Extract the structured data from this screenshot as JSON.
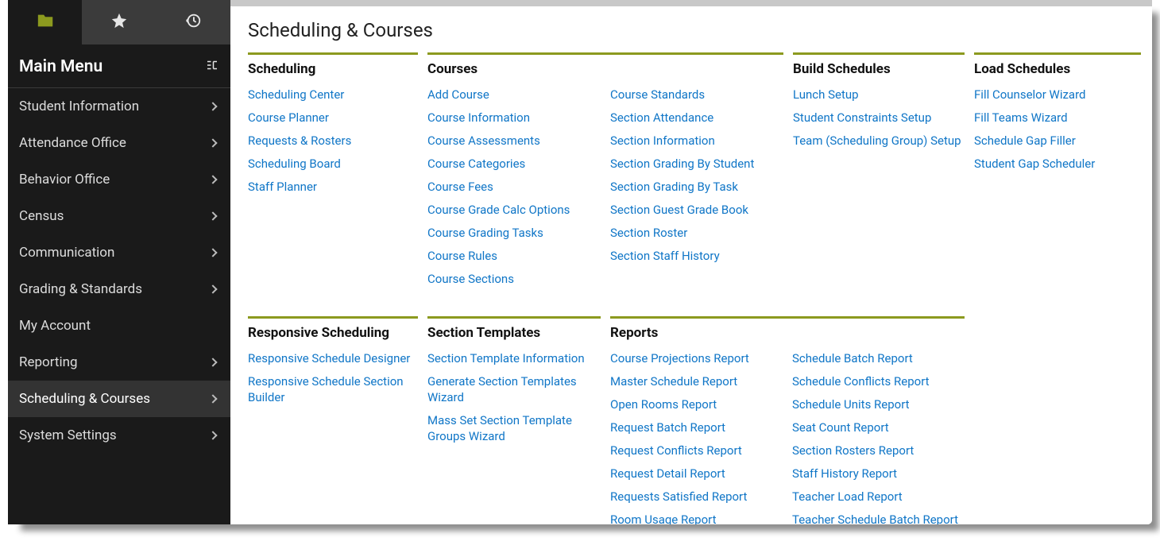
{
  "sidebar": {
    "title": "Main Menu",
    "items": [
      {
        "label": "Student Information",
        "sub": true
      },
      {
        "label": "Attendance Office",
        "sub": true
      },
      {
        "label": "Behavior Office",
        "sub": true
      },
      {
        "label": "Census",
        "sub": true
      },
      {
        "label": "Communication",
        "sub": true
      },
      {
        "label": "Grading & Standards",
        "sub": true
      },
      {
        "label": "My Account",
        "sub": false
      },
      {
        "label": "Reporting",
        "sub": true
      },
      {
        "label": "Scheduling & Courses",
        "sub": true,
        "active": true
      },
      {
        "label": "System Settings",
        "sub": true
      }
    ]
  },
  "page": {
    "title": "Scheduling & Courses"
  },
  "sections": {
    "scheduling": {
      "title": "Scheduling",
      "links": [
        "Scheduling Center",
        "Course Planner",
        "Requests & Rosters",
        "Scheduling Board",
        "Staff Planner"
      ]
    },
    "courses": {
      "title": "Courses",
      "col1": [
        "Add Course",
        "Course Information",
        "Course Assessments",
        "Course Categories",
        "Course Fees",
        "Course Grade Calc Options",
        "Course Grading Tasks",
        "Course Rules",
        "Course Sections"
      ],
      "col2": [
        "Course Standards",
        "Section Attendance",
        "Section Information",
        "Section Grading By Student",
        "Section Grading By Task",
        "Section Guest Grade Book",
        "Section Roster",
        "Section Staff History"
      ]
    },
    "build": {
      "title": "Build Schedules",
      "links": [
        "Lunch Setup",
        "Student Constraints Setup",
        "Team (Scheduling Group) Setup"
      ]
    },
    "load": {
      "title": "Load Schedules",
      "links": [
        "Fill Counselor Wizard",
        "Fill Teams Wizard",
        "Schedule Gap Filler",
        "Student Gap Scheduler"
      ]
    },
    "responsive": {
      "title": "Responsive Scheduling",
      "links": [
        "Responsive Schedule Designer",
        "Responsive Schedule Section Builder"
      ]
    },
    "templates": {
      "title": "Section Templates",
      "links": [
        "Section Template Information",
        "Generate Section Templates Wizard",
        "Mass Set Section Template Groups Wizard"
      ]
    },
    "reports": {
      "title": "Reports",
      "col1": [
        "Course Projections Report",
        "Master Schedule Report",
        "Open Rooms Report",
        "Request Batch Report",
        "Request Conflicts Report",
        "Request Detail Report",
        "Requests Satisfied Report",
        "Room Usage Report"
      ],
      "col2": [
        "Schedule Batch Report",
        "Schedule Conflicts Report",
        "Schedule Units Report",
        "Seat Count Report",
        "Section Rosters Report",
        "Staff History Report",
        "Teacher Load Report",
        "Teacher Schedule Batch Report"
      ]
    }
  }
}
